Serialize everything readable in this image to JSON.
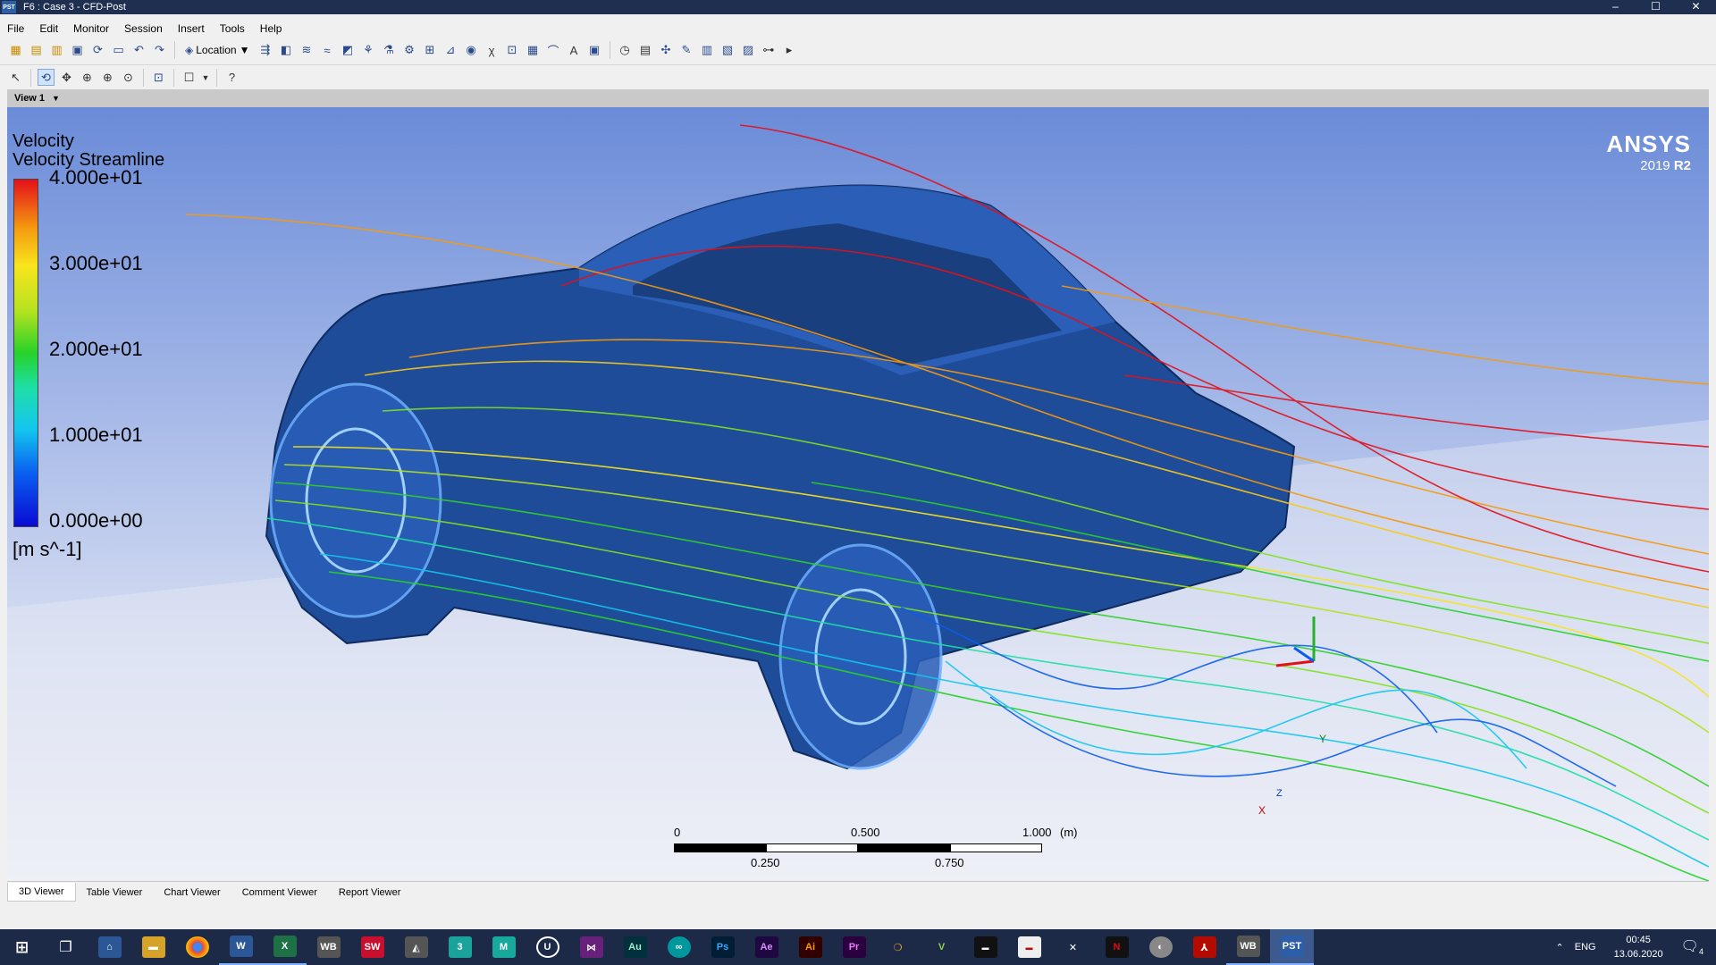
{
  "window": {
    "app_icon": "PST",
    "title": "F6 : Case 3 - CFD-Post",
    "controls": [
      "–",
      "☐",
      "✕"
    ]
  },
  "menu": [
    "File",
    "Edit",
    "Monitor",
    "Session",
    "Insert",
    "Tools",
    "Help"
  ],
  "toolbar": {
    "location_label": "Location"
  },
  "view": {
    "name": "View 1"
  },
  "legend": {
    "variable": "Velocity",
    "object": "Velocity Streamline",
    "ticks": [
      "4.000e+01",
      "3.000e+01",
      "2.000e+01",
      "1.000e+01",
      "0.000e+00"
    ],
    "unit": "[m s^-1]"
  },
  "logo": {
    "name": "ANSYS",
    "version_prefix": "2019 ",
    "version_suffix": "R2"
  },
  "scale_bar": {
    "top_labels": [
      "0",
      "0.500",
      "1.000"
    ],
    "unit": "(m)",
    "bottom_labels": [
      "0.250",
      "0.750"
    ]
  },
  "triad": {
    "x": "X",
    "y": "Y",
    "z": "Z"
  },
  "tabs": [
    "3D Viewer",
    "Table Viewer",
    "Chart Viewer",
    "Comment Viewer",
    "Report Viewer"
  ],
  "active_tab": "3D Viewer",
  "taskbar": {
    "apps": [
      {
        "label": "",
        "color": "#1c2a48"
      },
      {
        "label": "",
        "color": "#1c2a48"
      },
      {
        "label": "",
        "color": "#1c2a48"
      },
      {
        "label": "",
        "color": "#d6a328"
      },
      {
        "label": "",
        "color": "#1c2a48"
      },
      {
        "label": "W",
        "color": "#2b5797"
      },
      {
        "label": "X",
        "color": "#1e7145"
      },
      {
        "label": "WB",
        "color": "#555555"
      },
      {
        "label": "SW",
        "color": "#c8102e"
      },
      {
        "label": "",
        "color": "#555555"
      },
      {
        "label": "3",
        "color": "#1aa39a"
      },
      {
        "label": "M",
        "color": "#18a99d"
      },
      {
        "label": "U",
        "color": "#1c2a48"
      },
      {
        "label": "",
        "color": "#68217a"
      },
      {
        "label": "Au",
        "color": "#00313c"
      },
      {
        "label": "",
        "color": "#00979d"
      },
      {
        "label": "Ps",
        "color": "#001e36"
      },
      {
        "label": "Ae",
        "color": "#1f0740"
      },
      {
        "label": "Ai",
        "color": "#330000"
      },
      {
        "label": "Pr",
        "color": "#2a003f"
      },
      {
        "label": "",
        "color": "#1c2a48"
      },
      {
        "label": "",
        "color": "#1c2a48"
      },
      {
        "label": "",
        "color": "#111111"
      },
      {
        "label": "",
        "color": "#eeeeee"
      },
      {
        "label": "",
        "color": "#1c2a48"
      },
      {
        "label": "N",
        "color": "#e50914"
      },
      {
        "label": "",
        "color": "#1c2a48"
      },
      {
        "label": "",
        "color": "#b30b00"
      },
      {
        "label": "WB",
        "color": "#555555"
      },
      {
        "label": "PST",
        "color": "#2c5fa8"
      }
    ],
    "lang": "ENG",
    "time": "00:45",
    "date": "13.06.2020",
    "notifications": "4"
  }
}
